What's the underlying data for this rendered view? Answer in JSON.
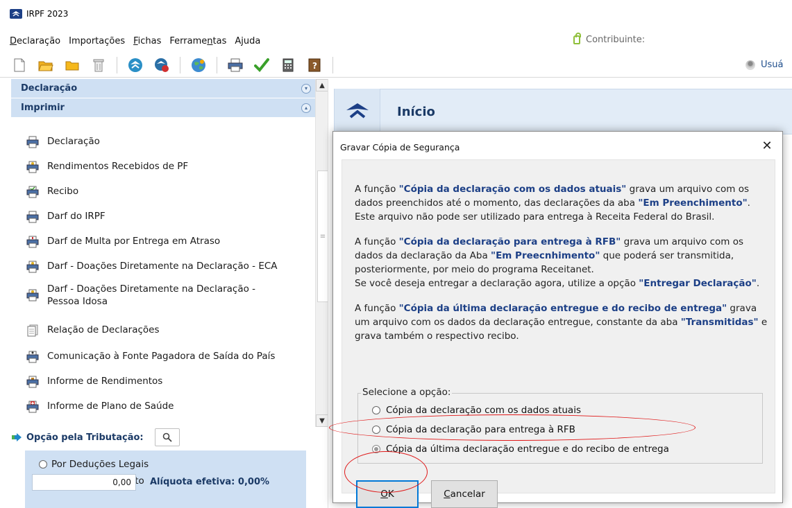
{
  "window": {
    "title": "IRPF 2023"
  },
  "menu": {
    "items": [
      {
        "label": "Declaração",
        "accel": "D"
      },
      {
        "label": "Importações",
        "accel": ""
      },
      {
        "label": "Fichas",
        "accel": "F"
      },
      {
        "label": "Ferramentas",
        "accel": ""
      },
      {
        "label": "Ajuda",
        "accel": ""
      }
    ],
    "contribuinte_label": "Contribuinte:",
    "usuario_label": "Usuá"
  },
  "left_panel": {
    "declaracao_header": "Declaração",
    "imprimir_header": "Imprimir",
    "print_items": [
      "Declaração",
      "Rendimentos Recebidos de PF",
      "Recibo",
      "Darf do IRPF",
      "Darf de Multa por Entrega em Atraso",
      "Darf - Doações Diretamente na Declaração - ECA",
      "Darf - Doações Diretamente na Declaração - Pessoa Idosa",
      "Relação de Declarações",
      "Comunicação à Fonte Pagadora de Saída do País",
      "Informe de Rendimentos",
      "Informe de Plano de Saúde"
    ],
    "tributacao": {
      "label": "Opção pela Tributação:",
      "option": "Por Deduções Legais",
      "saldo": "Sem Saldo de Imposto",
      "value": "0,00",
      "aliquota": "Alíquota efetiva: 0,00%"
    }
  },
  "right_panel": {
    "inicio_title": "Início"
  },
  "dialog": {
    "title": "Gravar Cópia de Segurança",
    "paragraph1": {
      "pre": "A função ",
      "hl1": "\"Cópia da declaração com os dados atuais\"",
      "mid": " grava um arquivo com os dados preenchidos até o momento, das declarações da aba ",
      "hl2": "\"Em Preenchimento\"",
      "post": ". Este arquivo não pode ser utilizado para entrega à Receita Federal do Brasil."
    },
    "paragraph2": {
      "pre": "A função ",
      "hl1": "\"Cópia da declaração para entrega à RFB\"",
      "mid": " grava um arquivo com os dados da declaração da Aba ",
      "hl2": "\"Em Preecnhimento\"",
      "post": " que poderá ser transmitida, posteriormente, por meio do programa Receitanet.",
      "line2_pre": "Se você deseja entregar a declaração agora, utilize a opção ",
      "line2_hl": "\"Entregar Declaração\"",
      "line2_post": "."
    },
    "paragraph3": {
      "pre": "A função ",
      "hl1": "\"Cópia da última declaração entregue e do recibo de entrega\"",
      "mid": " grava um arquivo com os dados da declaração entregue, constante da aba ",
      "hl2": "\"Transmitidas\"",
      "post": " e grava também o respectivo recibo."
    },
    "group_label": "Selecione a opção:",
    "options": [
      "Cópia da declaração com os dados atuais",
      "Cópia da declaração para entrega à RFB",
      "Cópia da última declaração entregue e do recibo de entrega"
    ],
    "selected_option": 2,
    "ok_label": "OK",
    "cancel_label": "Cancelar",
    "colors": {
      "highlight": "#1c3f86",
      "annotation": "#e01818"
    }
  }
}
